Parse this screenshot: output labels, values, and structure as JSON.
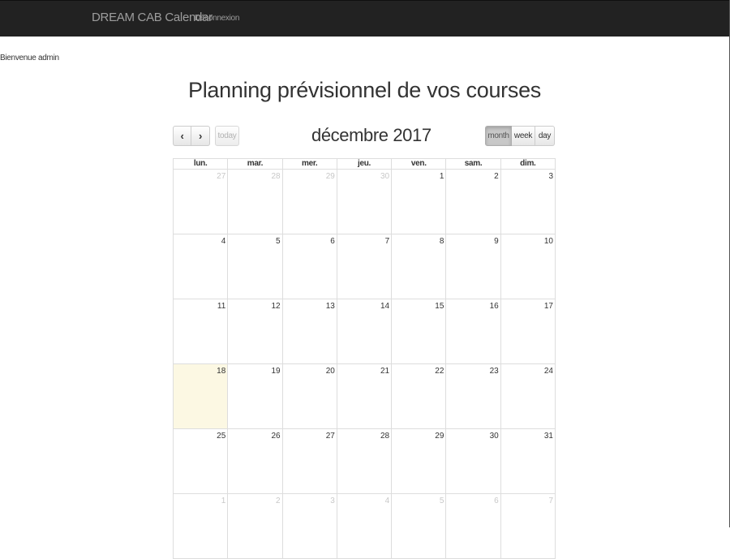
{
  "navbar": {
    "brand": "DREAM CAB Calendar",
    "logout": "Déconnexion"
  },
  "welcome": "Bienvenue admin",
  "page_title": "Planning prévisionnel de vos courses",
  "toolbar": {
    "prev_icon": "‹",
    "next_icon": "›",
    "today_label": "today",
    "month_title": "décembre 2017",
    "views": [
      "month",
      "week",
      "day"
    ],
    "active_view": "month"
  },
  "calendar": {
    "weekdays": [
      "lun.",
      "mar.",
      "mer.",
      "jeu.",
      "ven.",
      "sam.",
      "dim."
    ],
    "today": "18",
    "weeks": [
      [
        {
          "d": "27",
          "o": true
        },
        {
          "d": "28",
          "o": true
        },
        {
          "d": "29",
          "o": true
        },
        {
          "d": "30",
          "o": true
        },
        {
          "d": "1"
        },
        {
          "d": "2"
        },
        {
          "d": "3"
        }
      ],
      [
        {
          "d": "4"
        },
        {
          "d": "5"
        },
        {
          "d": "6"
        },
        {
          "d": "7"
        },
        {
          "d": "8"
        },
        {
          "d": "9"
        },
        {
          "d": "10"
        }
      ],
      [
        {
          "d": "11"
        },
        {
          "d": "12"
        },
        {
          "d": "13"
        },
        {
          "d": "14"
        },
        {
          "d": "15"
        },
        {
          "d": "16"
        },
        {
          "d": "17"
        }
      ],
      [
        {
          "d": "18",
          "t": true
        },
        {
          "d": "19"
        },
        {
          "d": "20"
        },
        {
          "d": "21"
        },
        {
          "d": "22"
        },
        {
          "d": "23"
        },
        {
          "d": "24"
        }
      ],
      [
        {
          "d": "25"
        },
        {
          "d": "26"
        },
        {
          "d": "27"
        },
        {
          "d": "28"
        },
        {
          "d": "29"
        },
        {
          "d": "30"
        },
        {
          "d": "31"
        }
      ],
      [
        {
          "d": "1",
          "o": true
        },
        {
          "d": "2",
          "o": true
        },
        {
          "d": "3",
          "o": true
        },
        {
          "d": "4",
          "o": true
        },
        {
          "d": "5",
          "o": true
        },
        {
          "d": "6",
          "o": true
        },
        {
          "d": "7",
          "o": true
        }
      ]
    ]
  }
}
